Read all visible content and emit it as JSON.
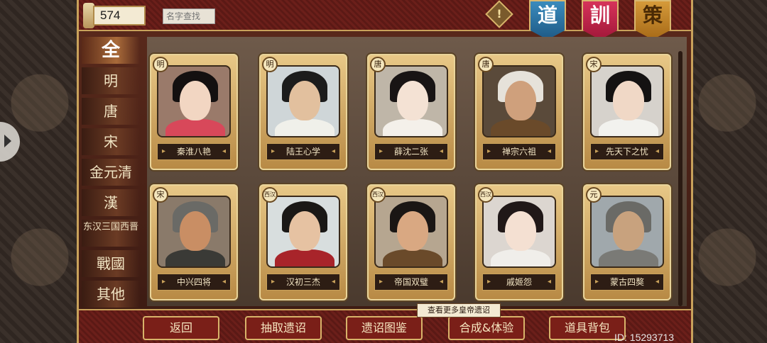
{
  "header": {
    "count_value": "574",
    "search_placeholder": "名字查找",
    "banners": [
      "道",
      "訓",
      "策"
    ]
  },
  "nav": {
    "items": [
      "全",
      "明",
      "唐",
      "宋",
      "金元清",
      "漢",
      "东汉三国西晋",
      "戰國",
      "其他"
    ],
    "active_index": 0
  },
  "cards": [
    {
      "badge": "明",
      "name": "秦淮八艳",
      "skin": "#f2d6c2",
      "hair": "#141010",
      "body": "#d8485a",
      "bg": "#9a7a6a"
    },
    {
      "badge": "明",
      "name": "陆王心学",
      "skin": "#e2c09e",
      "hair": "#1c1c1c",
      "body": "#f0f0ea",
      "bg": "#cfd6d8"
    },
    {
      "badge": "唐",
      "name": "薛沈二张",
      "skin": "#f4e2d4",
      "hair": "#181414",
      "body": "#f4f0ea",
      "bg": "#bfb6a8"
    },
    {
      "badge": "唐",
      "name": "禅宗六祖",
      "skin": "#cfa07c",
      "hair": "#e6e2da",
      "body": "#6a4a2a",
      "bg": "#5a4a3a"
    },
    {
      "badge": "宋",
      "name": "先天下之忧",
      "skin": "#f0d8c6",
      "hair": "#141212",
      "body": "#f2f2ee",
      "bg": "#d6d2cc"
    },
    {
      "badge": "宋",
      "name": "中兴四将",
      "skin": "#c98e64",
      "hair": "#6a6a66",
      "body": "#3a3a36",
      "bg": "#8a7a6a"
    },
    {
      "badge": "西汉",
      "name": "汉初三杰",
      "skin": "#e6c2a2",
      "hair": "#1a1816",
      "body": "#a8242a",
      "bg": "#d8dede"
    },
    {
      "badge": "西汉",
      "name": "帝国双璧",
      "skin": "#d9a882",
      "hair": "#1a1614",
      "body": "#6a4a2a",
      "bg": "#b6a690"
    },
    {
      "badge": "西汉",
      "name": "戚姬怨",
      "skin": "#f4e0d2",
      "hair": "#201818",
      "body": "#f0eeea",
      "bg": "#dcd6d0"
    },
    {
      "badge": "元",
      "name": "蒙古四獒",
      "skin": "#c8a27e",
      "hair": "#6a6a66",
      "body": "#7a7a76",
      "bg": "#a0a8ac"
    }
  ],
  "footer": {
    "buttons": [
      "返回",
      "抽取遗诏",
      "遗诏图鉴",
      "合成&体验",
      "道具背包"
    ],
    "tooltip": "查看更多皇帝遗诏",
    "id_text": "ID: 15293713"
  }
}
